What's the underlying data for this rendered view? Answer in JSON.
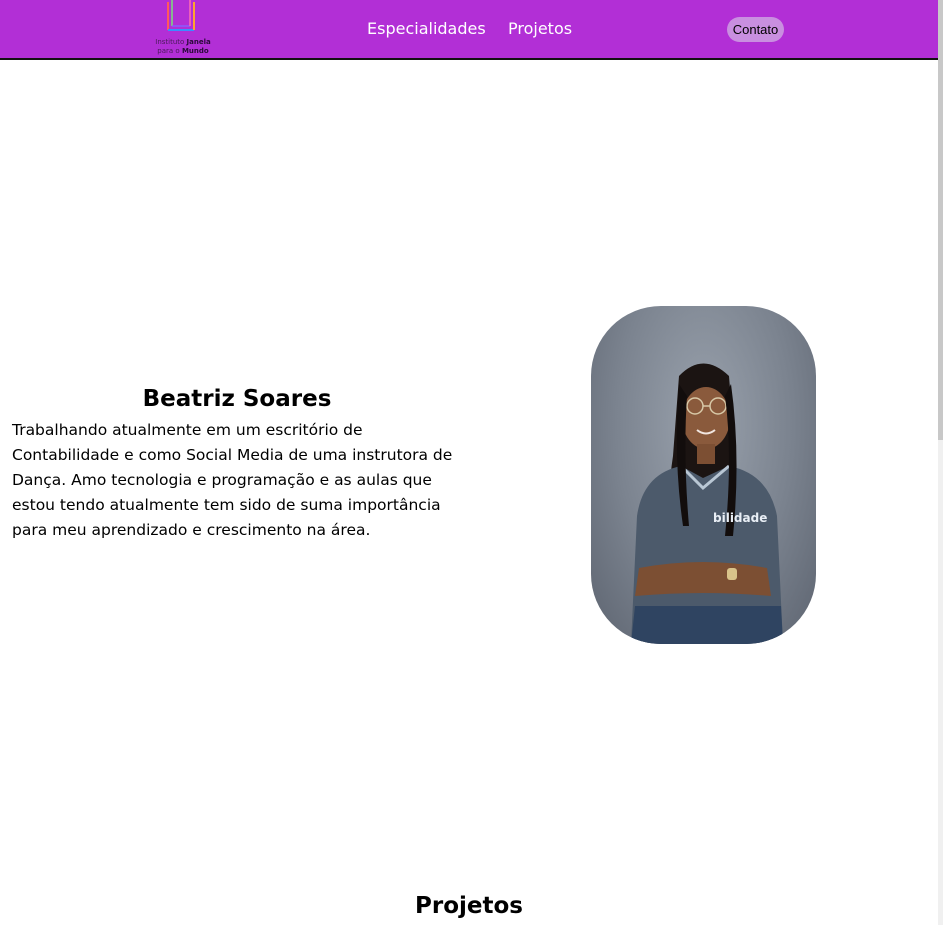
{
  "header": {
    "logo": {
      "line1_prefix": "Instituto ",
      "line1_bold": "Janela",
      "line2_prefix": "para o ",
      "line2_bold": "Mundo"
    },
    "nav": [
      {
        "label": "Especialidades"
      },
      {
        "label": "Projetos"
      }
    ],
    "contact_label": "Contato",
    "colors": {
      "background": "#b22fd6",
      "contact_button": "#c98fe0"
    }
  },
  "profile": {
    "name": "Beatriz Soares",
    "bio": "Trabalhando atualmente em um escritório de Contabilidade e como Social Media de uma instrutora de Dança. Amo tecnologia e programação e as aulas que estou tendo atualmente tem sido de suma importância para meu aprendizado e crescimento na área.",
    "photo_shirt_text": "bilidade"
  },
  "sections": {
    "projects_title": "Projetos"
  }
}
